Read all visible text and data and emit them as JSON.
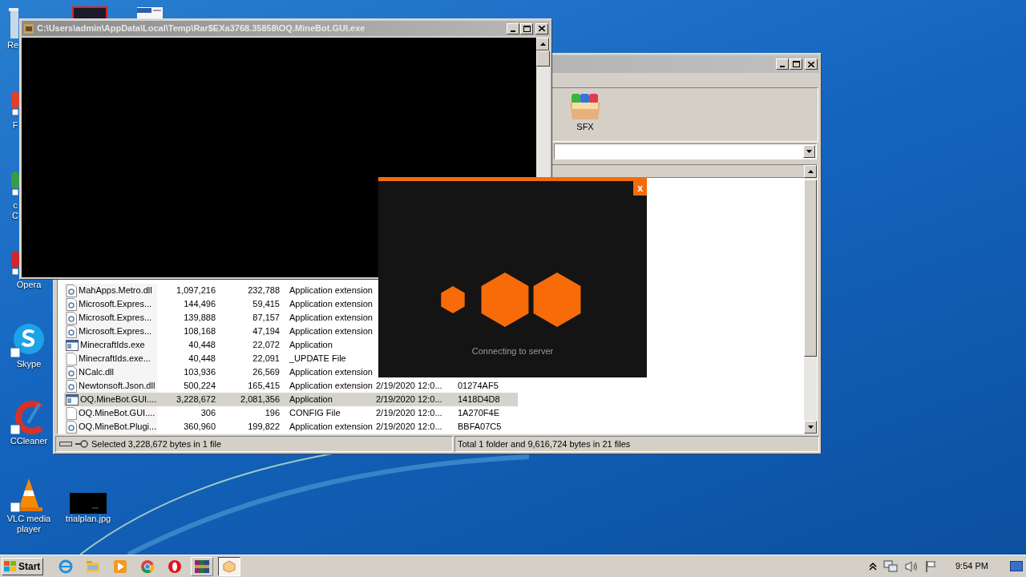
{
  "desktop_icons": [
    {
      "kind": "recycle",
      "lines": [
        "Re"
      ]
    },
    {
      "kind": "firefox",
      "lines": [
        "F"
      ]
    },
    {
      "kind": "chrome",
      "lines": [
        "c",
        "C"
      ]
    },
    {
      "kind": "opera",
      "lines": [
        "Opera"
      ]
    },
    {
      "kind": "skype",
      "lines": [
        "Skype"
      ]
    },
    {
      "kind": "ccleaner",
      "lines": [
        "CCleaner"
      ]
    },
    {
      "kind": "vlc",
      "lines": [
        "VLC media player"
      ]
    },
    {
      "kind": "image",
      "lines": [
        "trialplan.jpg"
      ]
    }
  ],
  "console_window": {
    "title": "C:\\Users\\admin\\AppData\\Local\\Temp\\Rar$EXa3768.35858\\OQ.MineBot.GUI.exe"
  },
  "archiver_window": {
    "toolbar": [
      {
        "label": "SFX"
      }
    ],
    "file_list": {
      "rows": [
        {
          "kind": "dll",
          "name": "MahApps.Metro.dll",
          "size": "1,097,216",
          "packed": "232,788",
          "type": "Application extension",
          "selected": false
        },
        {
          "kind": "dll",
          "name": "Microsoft.Expres...",
          "size": "144,496",
          "packed": "59,415",
          "type": "Application extension",
          "selected": false
        },
        {
          "kind": "dll",
          "name": "Microsoft.Expres...",
          "size": "139,888",
          "packed": "87,157",
          "type": "Application extension",
          "selected": false
        },
        {
          "kind": "dll",
          "name": "Microsoft.Expres...",
          "size": "108,168",
          "packed": "47,194",
          "type": "Application extension",
          "selected": false
        },
        {
          "kind": "exe",
          "name": "MinecraftIds.exe",
          "size": "40,448",
          "packed": "22,072",
          "type": "Application",
          "selected": false
        },
        {
          "kind": "file",
          "name": "MinecraftIds.exe...",
          "size": "40,448",
          "packed": "22,091",
          "type": "_UPDATE File",
          "selected": false
        },
        {
          "kind": "dll",
          "name": "NCalc.dll",
          "size": "103,936",
          "packed": "26,569",
          "type": "Application extension",
          "selected": false
        },
        {
          "kind": "dll",
          "name": "Newtonsoft.Json.dll",
          "size": "500,224",
          "packed": "165,415",
          "type": "Application extension",
          "modified": "2/19/2020 12:0...",
          "crc": "01274AF5",
          "selected": false
        },
        {
          "kind": "exe",
          "name": "OQ.MineBot.GUI....",
          "size": "3,228,672",
          "packed": "2,081,356",
          "type": "Application",
          "modified": "2/19/2020 12:0...",
          "crc": "1418D4D8",
          "selected": true
        },
        {
          "kind": "file",
          "name": "OQ.MineBot.GUI....",
          "size": "306",
          "packed": "196",
          "type": "CONFIG File",
          "modified": "2/19/2020 12:0...",
          "crc": "1A270F4E",
          "selected": false
        },
        {
          "kind": "dll",
          "name": "OQ.MineBot.Plugi...",
          "size": "360,960",
          "packed": "199,822",
          "type": "Application extension",
          "modified": "2/19/2020 12:0...",
          "crc": "BBFA07C5",
          "selected": false
        }
      ]
    },
    "status_left": "Selected 3,228,672 bytes in 1 file",
    "status_right": "Total 1 folder and 9,616,724 bytes in 21 files"
  },
  "splash": {
    "status": "Connecting to server",
    "close": "x"
  },
  "taskbar": {
    "start": "Start",
    "apps": [
      {
        "kind": "ie",
        "selected": false
      },
      {
        "kind": "explorer",
        "selected": false
      },
      {
        "kind": "media",
        "selected": false
      },
      {
        "kind": "chrome",
        "selected": false
      },
      {
        "kind": "opera",
        "selected": false
      },
      {
        "kind": "winrar",
        "selected": false
      },
      {
        "kind": "box",
        "selected": true
      }
    ],
    "clock": "9:54 PM"
  }
}
